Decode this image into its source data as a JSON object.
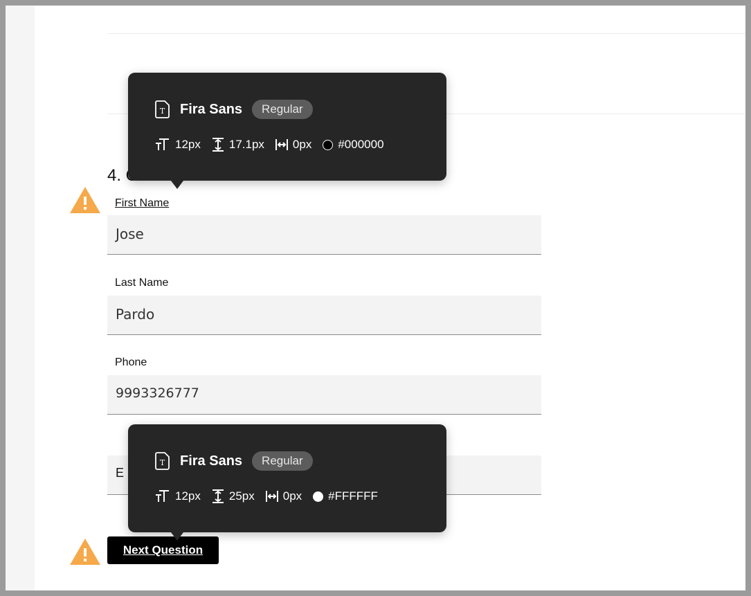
{
  "form": {
    "section_title": "4. Contact information",
    "fields": [
      {
        "label": "First Name",
        "value": "Jose"
      },
      {
        "label": "Last Name",
        "value": "Pardo"
      },
      {
        "label": "Phone",
        "value": "9993326777"
      },
      {
        "label": "Email",
        "value": ""
      }
    ],
    "email_label_visible": "E",
    "next_button": "Next Question"
  },
  "tooltips": [
    {
      "font": "Fira Sans",
      "style": "Regular",
      "size": "12px",
      "line_height": "17.1px",
      "letter_spacing": "0px",
      "color_hex": "#000000",
      "swatch_color": "#000000"
    },
    {
      "font": "Fira Sans",
      "style": "Regular",
      "size": "12px",
      "line_height": "25px",
      "letter_spacing": "0px",
      "color_hex": "#FFFFFF",
      "swatch_color": "#FFFFFF"
    }
  ],
  "icons": {
    "warning": "warning-icon",
    "font_file": "font-file-icon",
    "font_size": "font-size-icon",
    "line_height": "line-height-icon",
    "letter_spacing": "letter-spacing-icon"
  },
  "colors": {
    "warning": "#f5a94a",
    "tooltip_bg": "#262626",
    "field_bg": "#f3f3f3"
  }
}
